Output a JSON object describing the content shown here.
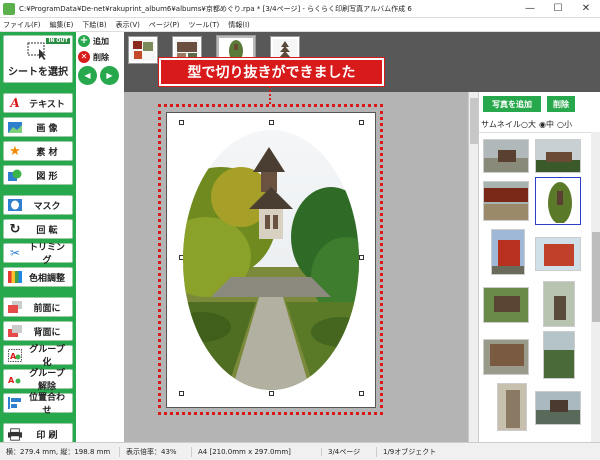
{
  "window": {
    "title": "C:¥ProgramData¥De-net¥rakuprint_album6¥albums¥京都めぐり.rpa * [3/4ページ] - らくらく印刷写真アルバム作成 6",
    "minimize": "—",
    "maximize": "☐",
    "close": "✕"
  },
  "menu": [
    "ファイル(F)",
    "編集(E)",
    "下絵(B)",
    "表示(V)",
    "ページ(P)",
    "ツール(T)",
    "情報(I)"
  ],
  "left_panel": {
    "inout_badge": "IN OUT",
    "select_sheet": "シートを選択",
    "text": "テキスト",
    "image": "画 像",
    "material": "素 材",
    "shape": "図 形",
    "mask": "マスク",
    "rotate": "回 転",
    "trimming": "トリミング",
    "color_adjust": "色相調整",
    "bring_front": "前面に",
    "send_back": "背面に",
    "group": "グループ化",
    "ungroup": "グループ解除",
    "align": "位置合わせ",
    "print": "印 刷"
  },
  "page_tools": {
    "add": "追加",
    "delete": "削除",
    "prev": "◀",
    "next": "▶"
  },
  "callout": "型で切り抜きができました",
  "right_panel": {
    "add_photo": "写真を追加",
    "delete": "削除",
    "thumbnail_label": "サムネイル",
    "sizes": [
      "大",
      "中",
      "小"
    ],
    "selected_size": "中"
  },
  "status": {
    "dimensions": "横：279.4 mm, 縦：198.8 mm",
    "zoom": "表示倍率：43%",
    "paper": "A4 [210.0mm x 297.0mm]",
    "page": "3/4ページ",
    "objects": "1/9オブジェクト"
  },
  "colors": {
    "brand_green": "#28a84d",
    "callout_red": "#d81a1a",
    "selection_blue": "#2b3fc8"
  }
}
